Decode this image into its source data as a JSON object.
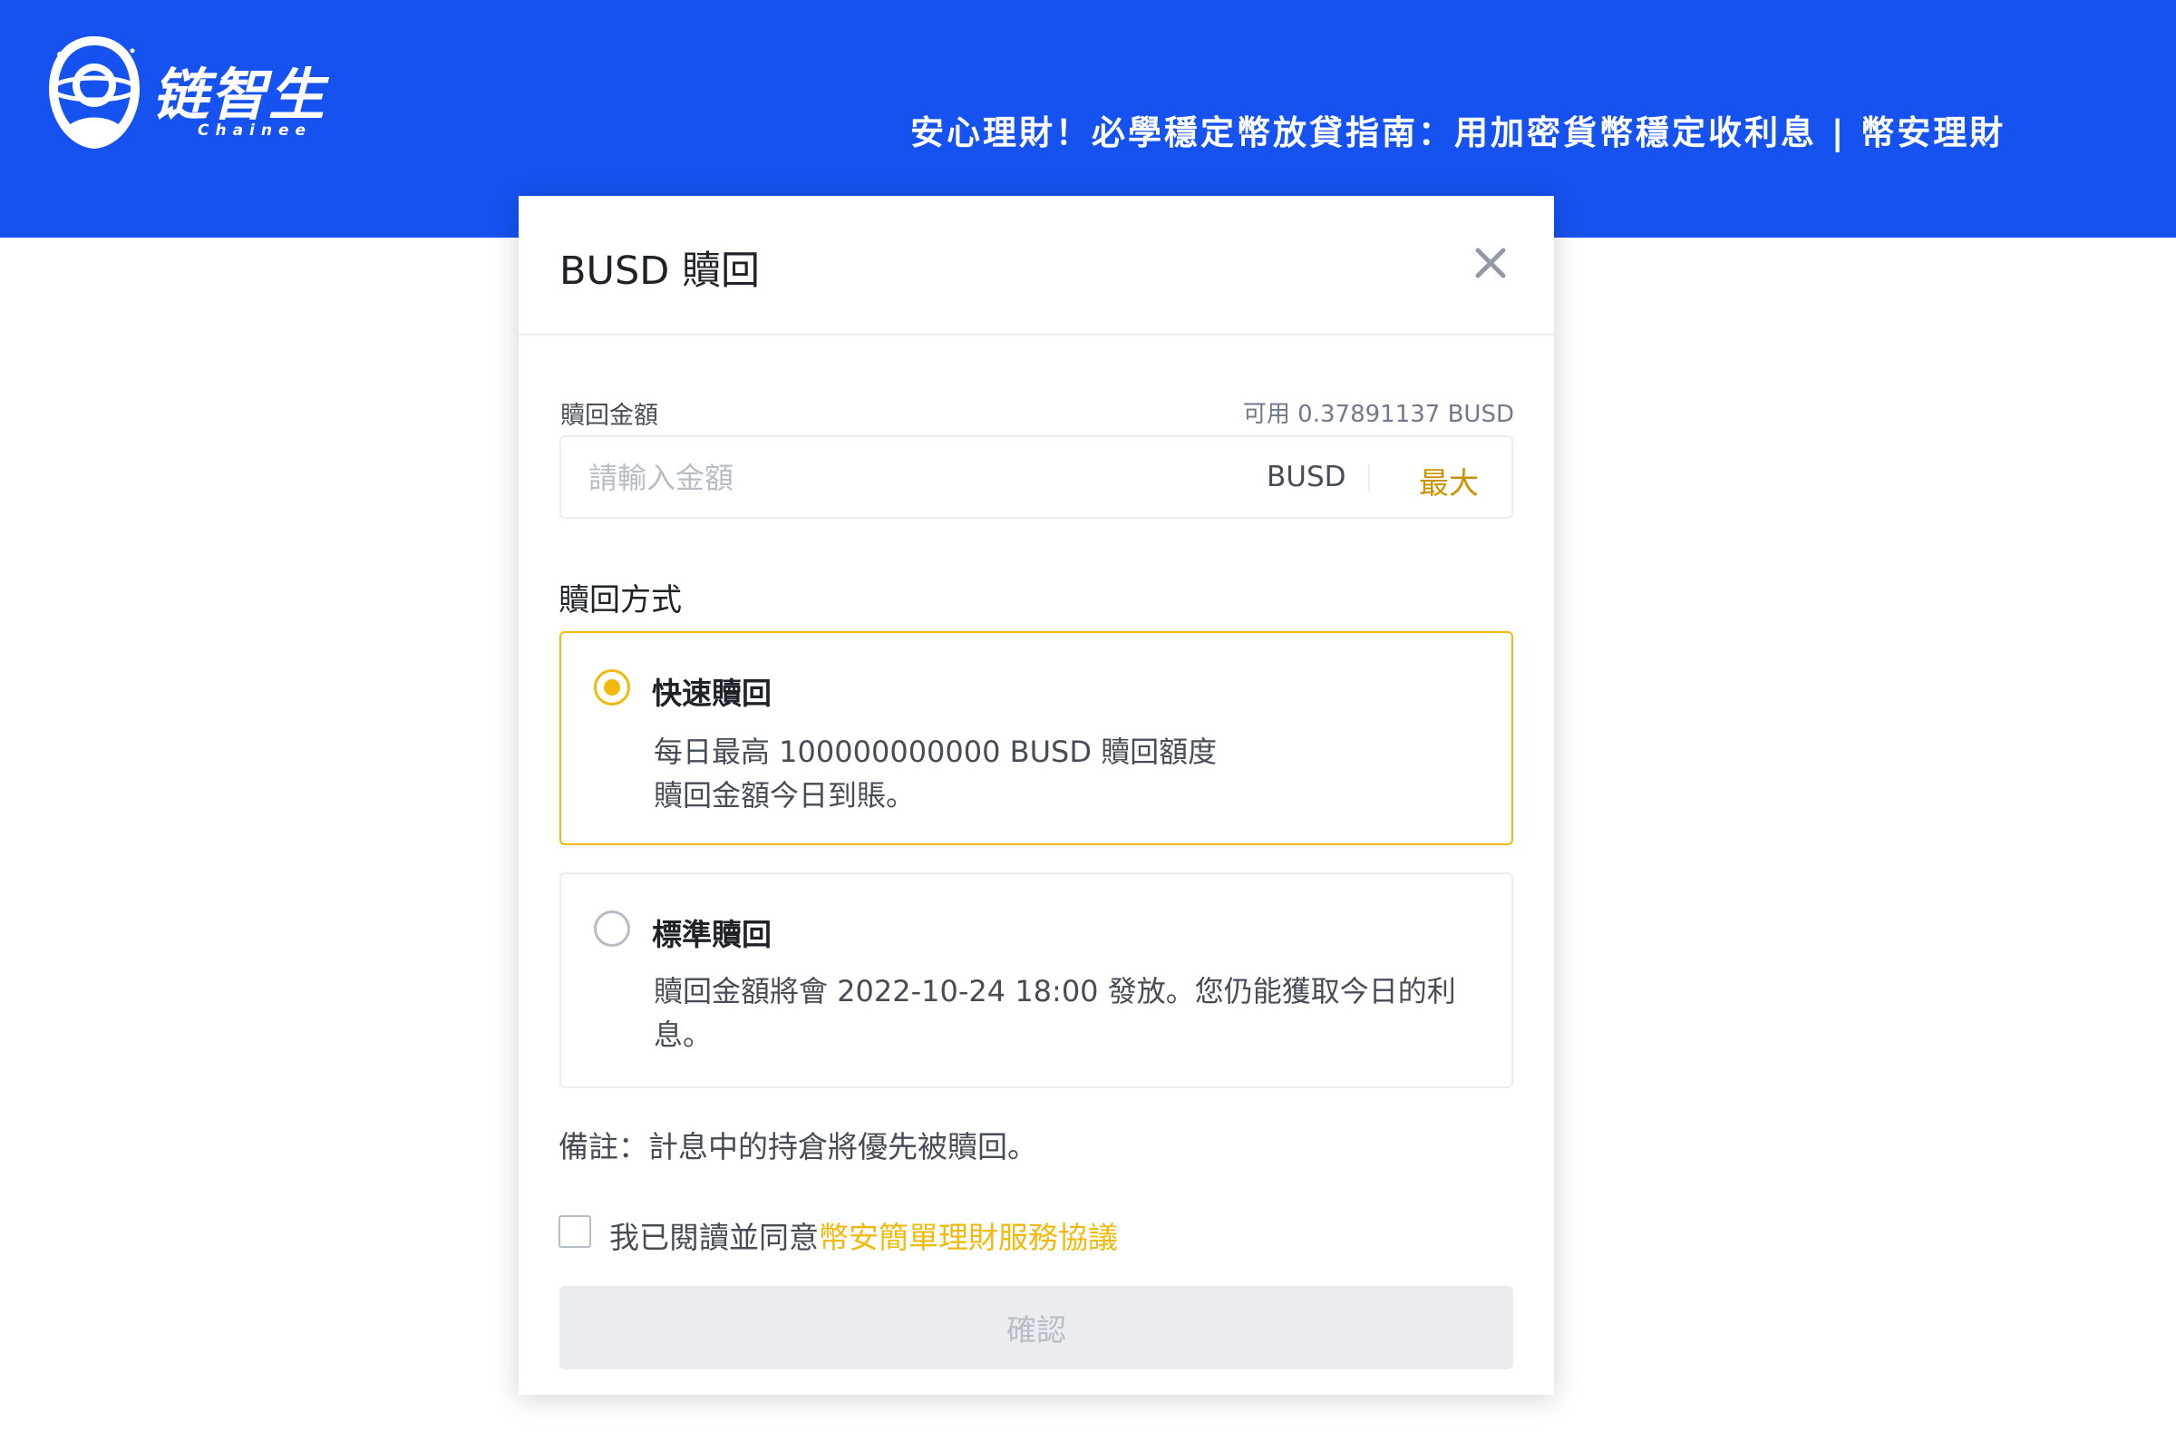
{
  "brand": {
    "name": "链智生",
    "sub": "Chainee"
  },
  "banner": {
    "title": "安心理財！必學穩定幣放貸指南：用加密貨幣穩定收利息 | 幣安理財"
  },
  "modal": {
    "title": "BUSD 贖回",
    "amount": {
      "label": "贖回金額",
      "available": "可用 0.37891137 BUSD",
      "placeholder": "請輸入金額",
      "currency": "BUSD",
      "max_label": "最大"
    },
    "method_label": "贖回方式",
    "options": [
      {
        "title": "快速贖回",
        "selected": true,
        "lines": [
          "每日最高 100000000000 BUSD 贖回額度",
          "贖回金額今日到賬。"
        ]
      },
      {
        "title": "標準贖回",
        "selected": false,
        "lines": [
          "贖回金額將會 2022-10-24 18:00 發放。您仍能獲取今日的利",
          "息。"
        ]
      }
    ],
    "note": "備註：計息中的持倉將優先被贖回。",
    "agreement": {
      "prefix": "我已閱讀並同意",
      "link": "幣安簡單理財服務協議",
      "checked": false
    },
    "confirm_label": "確認"
  },
  "colors": {
    "banner": "#1652f0",
    "accent": "#f0b90b",
    "link": "#f0b90b",
    "max": "#c99400"
  },
  "icons": {
    "close": "close-icon",
    "logo": "astronaut-logo-icon"
  }
}
